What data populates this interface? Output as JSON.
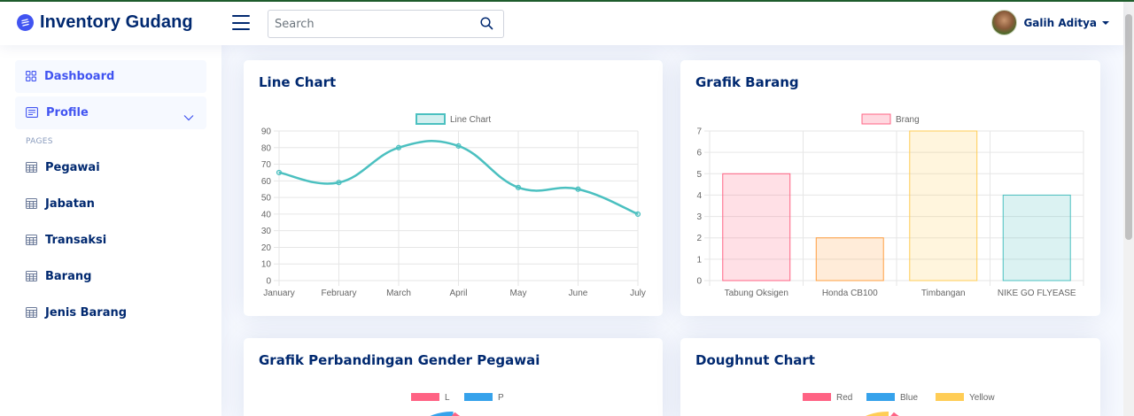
{
  "app": {
    "title": "Inventory Gudang"
  },
  "search": {
    "placeholder": "Search"
  },
  "user": {
    "name": "Galih Aditya"
  },
  "sidebar": {
    "items": [
      {
        "label": "Dashboard",
        "icon": "grid-icon",
        "active": true
      },
      {
        "label": "Profile",
        "icon": "menu-card-icon",
        "expandable": true
      }
    ],
    "heading": "PAGES",
    "pages": [
      {
        "label": "Pegawai",
        "icon": "table-icon"
      },
      {
        "label": "Jabatan",
        "icon": "table-icon"
      },
      {
        "label": "Transaksi",
        "icon": "table-icon"
      },
      {
        "label": "Barang",
        "icon": "table-icon"
      },
      {
        "label": "Jenis Barang",
        "icon": "table-icon"
      }
    ]
  },
  "cards": {
    "line": {
      "title": "Line Chart"
    },
    "bar": {
      "title": "Grafik Barang"
    },
    "gender": {
      "title": "Grafik Perbandingan Gender Pegawai"
    },
    "doughnut": {
      "title": "Doughnut Chart"
    }
  },
  "colors": {
    "accent": "#4154f1",
    "navy": "#012970",
    "teal": "#4bc0c0"
  },
  "chart_data": [
    {
      "type": "line",
      "categories": [
        "January",
        "February",
        "March",
        "April",
        "May",
        "June",
        "July"
      ],
      "series": [
        {
          "name": "Line Chart",
          "values": [
            65,
            59,
            80,
            81,
            56,
            55,
            40
          ],
          "color": "#4bc0c0"
        }
      ],
      "ylim": [
        0,
        90
      ],
      "yticks": [
        0,
        10,
        20,
        30,
        40,
        50,
        60,
        70,
        80,
        90
      ],
      "grid": true,
      "legend": "top"
    },
    {
      "type": "bar",
      "categories": [
        "Tabung Oksigen",
        "Honda CB100",
        "Timbangan",
        "NIKE GO FLYEASE"
      ],
      "series": [
        {
          "name": "Brang",
          "values": [
            5,
            2,
            7,
            4
          ]
        }
      ],
      "bar_colors": [
        "#ff6384",
        "#ff9f40",
        "#ffcd56",
        "#4bc0c0"
      ],
      "ylim": [
        0,
        7
      ],
      "yticks": [
        0,
        1,
        2,
        3,
        4,
        5,
        6,
        7
      ],
      "grid": true,
      "legend": "top"
    },
    {
      "type": "pie",
      "legend_entries": [
        {
          "name": "L",
          "color": "#ff6384"
        },
        {
          "name": "P",
          "color": "#36a2eb"
        }
      ],
      "legend": "top"
    },
    {
      "type": "pie",
      "legend_entries": [
        {
          "name": "Red",
          "color": "#ff6384"
        },
        {
          "name": "Blue",
          "color": "#36a2eb"
        },
        {
          "name": "Yellow",
          "color": "#ffcd56"
        }
      ],
      "legend": "top"
    }
  ]
}
